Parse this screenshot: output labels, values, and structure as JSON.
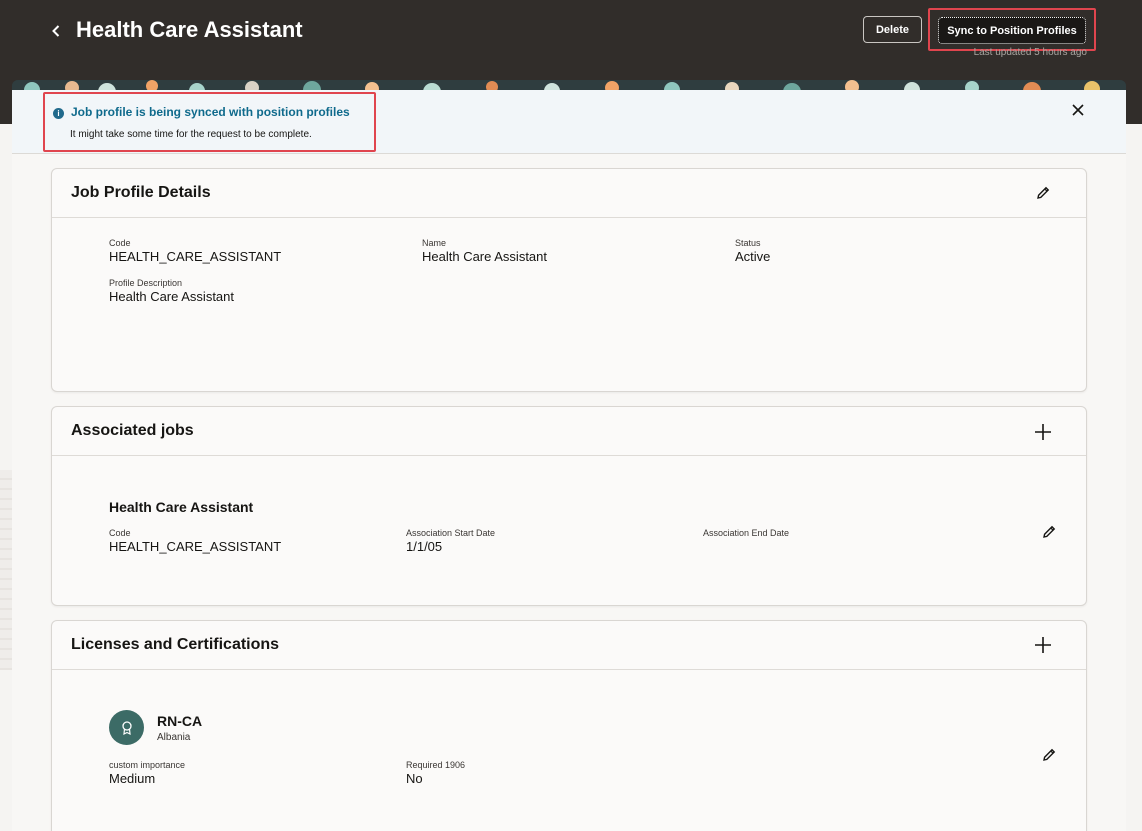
{
  "header": {
    "title": "Health Care Assistant",
    "delete_label": "Delete",
    "sync_label": "Sync to Position Profiles",
    "last_updated": "Last updated 5 hours ago"
  },
  "notice": {
    "title": "Job profile is being synced with position profiles",
    "message": "It might take some time for the request to be complete."
  },
  "job_profile_details": {
    "title": "Job Profile Details",
    "fields": [
      {
        "label": "Code",
        "value": "HEALTH_CARE_ASSISTANT"
      },
      {
        "label": "Name",
        "value": "Health Care Assistant"
      },
      {
        "label": "Status",
        "value": "Active"
      },
      {
        "label": "Profile Description",
        "value": "Health Care Assistant"
      }
    ]
  },
  "associated_jobs": {
    "title": "Associated jobs",
    "items": [
      {
        "name": "Health Care Assistant",
        "fields": [
          {
            "label": "Code",
            "value": "HEALTH_CARE_ASSISTANT"
          },
          {
            "label": "Association Start Date",
            "value": "1/1/05"
          },
          {
            "label": "Association End Date",
            "value": ""
          }
        ]
      }
    ]
  },
  "licenses": {
    "title": "Licenses and Certifications",
    "items": [
      {
        "name": "RN-CA",
        "country": "Albania",
        "fields": [
          {
            "label": "custom importance",
            "value": "Medium"
          },
          {
            "label": "Required 1906",
            "value": "No"
          }
        ]
      }
    ]
  },
  "icons": {
    "back": "chevron-left-icon",
    "close": "close-icon",
    "edit": "pencil-icon",
    "add": "plus-icon",
    "info": "info-icon",
    "certificate": "certificate-icon"
  },
  "colors": {
    "header_bg": "#312d2a",
    "alert_red": "#e0454e",
    "info_blue": "#0f6a8c",
    "avatar_teal": "#3c6b66"
  }
}
